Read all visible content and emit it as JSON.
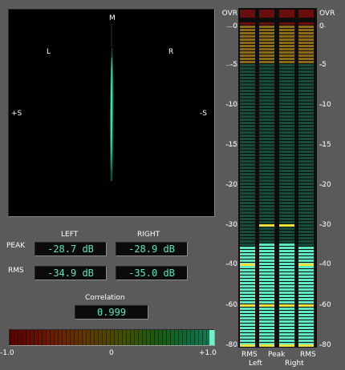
{
  "goniometer": {
    "label_m": "M",
    "label_l": "L",
    "label_r": "R",
    "label_plus_s": "+S",
    "label_minus_s": "-S",
    "trace_color": "#3de0b0"
  },
  "readouts": {
    "left_header": "LEFT",
    "right_header": "RIGHT",
    "peak_label": "PEAK",
    "rms_label": "RMS",
    "peak_left": "-28.7 dB",
    "peak_right": "-28.9 dB",
    "rms_left": "-34.9 dB",
    "rms_right": "-35.0 dB"
  },
  "correlation": {
    "label": "Correlation",
    "value": "0.999",
    "value_numeric": 0.999,
    "axis_min": "-1.0",
    "axis_mid": "0",
    "axis_max": "+1.0"
  },
  "meters": {
    "scale": [
      "OVR",
      "0",
      "-5",
      "-10",
      "-15",
      "-20",
      "-30",
      "-40",
      "-60",
      "-80"
    ],
    "columns": [
      {
        "id": "rms-left",
        "level_db": -35.0,
        "hold_db": -40
      },
      {
        "id": "peak-left",
        "level_db": -34.0,
        "hold_db": -30
      },
      {
        "id": "peak-right",
        "level_db": -34.0,
        "hold_db": -30
      },
      {
        "id": "rms-right",
        "level_db": -35.0,
        "hold_db": -40
      }
    ],
    "footer": {
      "rms1": "RMS",
      "peak": "Peak",
      "rms2": "RMS",
      "left": "Left",
      "right": "Right"
    },
    "colors": {
      "ovr": "#6a0d0d",
      "hot": "#8b6a1a",
      "off": "#154c3a",
      "lit": "#5fe8c4",
      "hold": "#f2e23c"
    }
  }
}
